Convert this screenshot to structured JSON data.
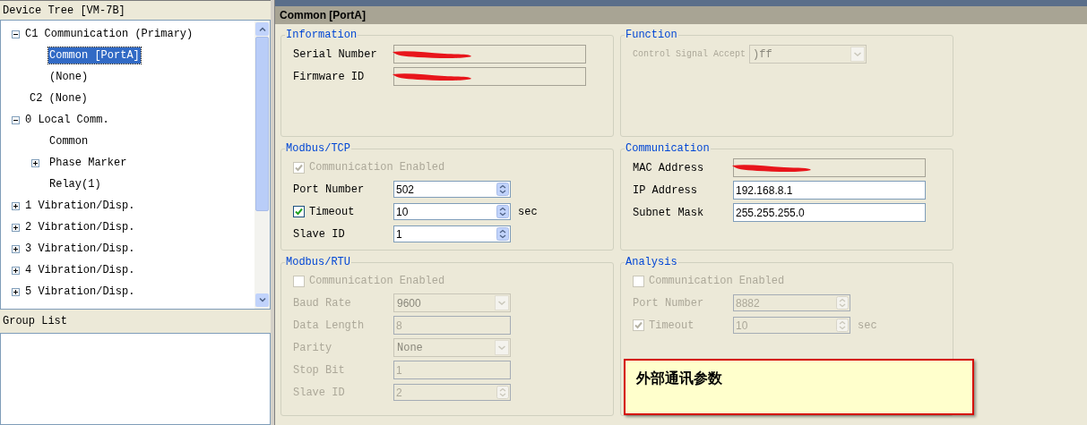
{
  "tree_panel": {
    "title": "Device Tree [VM-7B]",
    "items": [
      {
        "label": "C1 Communication (Primary)",
        "expanded": true,
        "selected": false,
        "children": [
          {
            "label": "Common [PortA]",
            "selected": true
          },
          {
            "label": "(None)",
            "selected": false
          }
        ]
      },
      {
        "label": "C2 (None)",
        "selected": false
      },
      {
        "label": "0 Local Comm.",
        "expanded": true,
        "selected": false,
        "children": [
          {
            "label": "Common",
            "selected": false
          },
          {
            "label": "Phase Marker",
            "expanded": false,
            "selected": false
          },
          {
            "label": "Relay(1)",
            "selected": false
          }
        ]
      },
      {
        "label": "1 Vibration/Disp.",
        "expanded": false,
        "selected": false
      },
      {
        "label": "2 Vibration/Disp.",
        "expanded": false,
        "selected": false
      },
      {
        "label": "3 Vibration/Disp.",
        "expanded": false,
        "selected": false
      },
      {
        "label": "4 Vibration/Disp.",
        "expanded": false,
        "selected": false
      },
      {
        "label": "5 Vibration/Disp.",
        "expanded": false,
        "selected": false
      }
    ]
  },
  "group_list": {
    "title": "Group List"
  },
  "content": {
    "title": "Common [PortA]",
    "groups": [
      {
        "title": "Information",
        "rows": [
          {
            "kind": "text",
            "label": "Serial Number",
            "disabled": false,
            "readonly": true,
            "redacted": true
          },
          {
            "kind": "text",
            "label": "Firmware ID",
            "disabled": false,
            "readonly": true,
            "redacted": true
          }
        ]
      },
      {
        "title": "Function",
        "rows": [
          {
            "kind": "select",
            "label": "Control Signal Accept",
            "value": ")ff",
            "disabled": true
          }
        ]
      },
      {
        "title": "Modbus/TCP",
        "rows": [
          {
            "kind": "checkbox",
            "label": "Communication Enabled",
            "checked": true,
            "disabled": true
          },
          {
            "kind": "spin",
            "label": "Port Number",
            "value": "502",
            "disabled": false
          },
          {
            "kind": "spin",
            "label": "Timeout",
            "value": "10",
            "unit": "sec",
            "checked": true,
            "disabled": false
          },
          {
            "kind": "spin",
            "label": "Slave ID",
            "value": "1",
            "disabled": false
          }
        ]
      },
      {
        "title": "Communication",
        "rows": [
          {
            "kind": "text",
            "label": "MAC Address",
            "disabled": false,
            "readonly": true,
            "redacted": true
          },
          {
            "kind": "text",
            "label": "IP Address",
            "value": "192.168.8.1",
            "disabled": false,
            "readonly": false
          },
          {
            "kind": "text",
            "label": "Subnet Mask",
            "value": "255.255.255.0",
            "disabled": false,
            "readonly": false
          }
        ]
      },
      {
        "title": "Modbus/RTU",
        "rows": [
          {
            "kind": "checkbox",
            "label": "Communication Enabled",
            "checked": false,
            "disabled": true
          },
          {
            "kind": "select",
            "label": "Baud Rate",
            "value": "9600",
            "disabled": true
          },
          {
            "kind": "text",
            "label": "Data Length",
            "value": "8",
            "disabled": true,
            "readonly": false
          },
          {
            "kind": "select",
            "label": "Parity",
            "value": "None",
            "disabled": true
          },
          {
            "kind": "text",
            "label": "Stop Bit",
            "value": "1",
            "disabled": true,
            "readonly": false
          },
          {
            "kind": "spin",
            "label": "Slave ID",
            "value": "2",
            "disabled": true
          }
        ]
      },
      {
        "title": "Analysis",
        "rows": [
          {
            "kind": "checkbox",
            "label": "Communication Enabled",
            "checked": false,
            "disabled": true
          },
          {
            "kind": "spin",
            "label": "Port Number",
            "value": "8882",
            "disabled": true
          },
          {
            "kind": "spin",
            "label": "Timeout",
            "value": "10",
            "unit": "sec",
            "checked": true,
            "disabled": true
          }
        ]
      }
    ]
  },
  "note": {
    "text": "外部通讯参数"
  }
}
